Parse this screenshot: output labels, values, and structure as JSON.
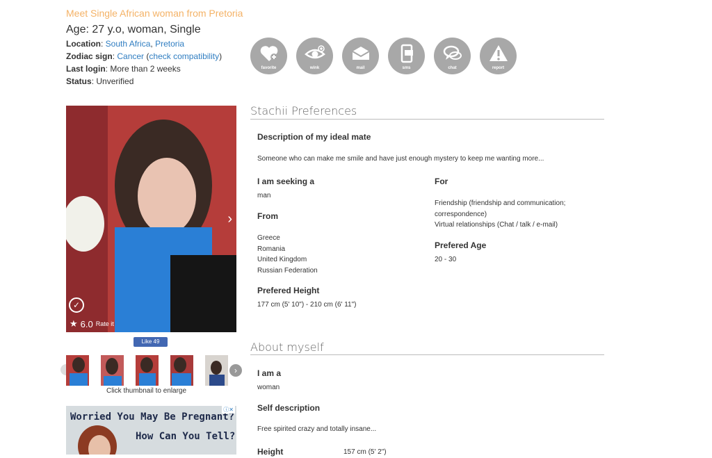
{
  "header": {
    "title": "Meet Single African woman from Pretoria",
    "age_line": "Age: 27 y.o, woman, Single",
    "location_label": "Location",
    "location_country": "South Africa",
    "location_city": "Pretoria",
    "zodiac_label": "Zodiac sign",
    "zodiac_value": "Cancer",
    "zodiac_link": "check compatibility",
    "last_login_label": "Last login",
    "last_login_value": "More than 2 weeks",
    "status_label": "Status",
    "status_value": "Unverified"
  },
  "actions": [
    {
      "label": "favorite",
      "icon": "heart-plus-icon"
    },
    {
      "label": "wink",
      "icon": "eye-icon"
    },
    {
      "label": "mail",
      "icon": "envelope-icon"
    },
    {
      "label": "sms",
      "icon": "phone-icon"
    },
    {
      "label": "chat",
      "icon": "chat-bubble-icon"
    },
    {
      "label": "report",
      "icon": "warning-icon"
    }
  ],
  "preferences": {
    "heading": "Stachii Preferences",
    "ideal_mate_label": "Description of my ideal mate",
    "ideal_mate_text": "Someone who can make me smile and have just enough mystery to keep me wanting more...",
    "seeking_label": "I am seeking a",
    "seeking_value": "man",
    "for_label": "For",
    "for_line1": "Friendship (friendship and communication;",
    "for_line2": "correspondence)",
    "for_line3": "Virtual relationships (Chat / talk / e-mail)",
    "from_label": "From",
    "from_values": [
      "Greece",
      "Romania",
      "United Kingdom",
      "Russian Federation"
    ],
    "age_label": "Prefered Age",
    "age_value": "20 - 30",
    "height_label": "Prefered Height",
    "height_value": "177 cm (5' 10\") - 210 cm (6' 11\")"
  },
  "about": {
    "heading": "About myself",
    "iam_label": "I am a",
    "iam_value": "woman",
    "self_label": "Self description",
    "self_value": "Free spirited crazy and totally insane...",
    "height_label": "Height",
    "height_value": "157 cm (5' 2\")"
  },
  "photo": {
    "rating": "6.0",
    "rate_label": "Rate it",
    "like_label": "Like 49",
    "thumb_caption": "Click thumbnail to enlarge"
  },
  "ad": {
    "line1": "Worried You May Be Pregnant?",
    "line2": "How Can You Tell?"
  },
  "colors": {
    "title": "#f4b266",
    "link": "#2f7dc1",
    "action_button": "#a8a8a8",
    "photo_bg": "#b03a3a"
  }
}
